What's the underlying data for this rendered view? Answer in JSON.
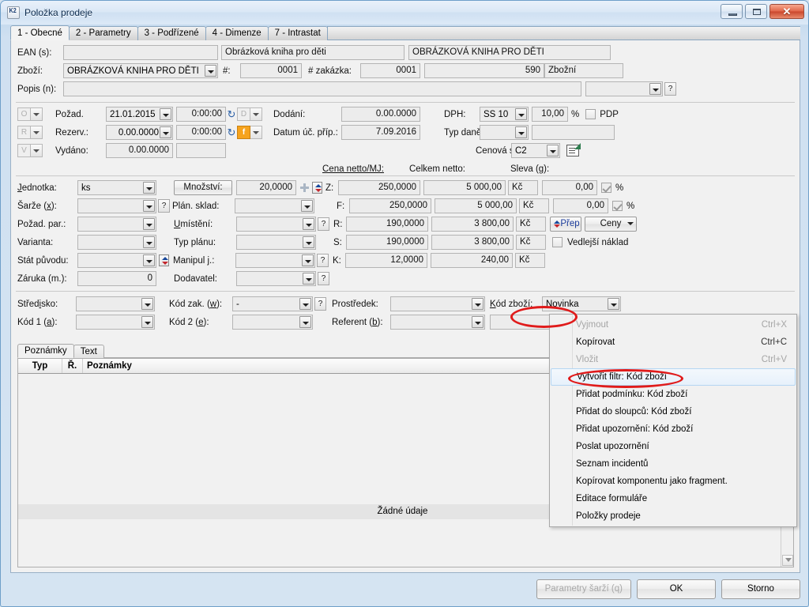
{
  "window": {
    "title": "Položka prodeje",
    "icon": "k2-app-icon",
    "buttons": {
      "minimize": "minimize-icon",
      "maximize": "maximize-icon",
      "close": "✕"
    }
  },
  "tabs": [
    {
      "label": "1 - Obecné",
      "active": true
    },
    {
      "label": "2 - Parametry",
      "active": false
    },
    {
      "label": "3 - Podřízené",
      "active": false
    },
    {
      "label": "4 - Dimenze",
      "active": false
    },
    {
      "label": "7 - Intrastat",
      "active": false
    }
  ],
  "header": {
    "ean_label": "EAN (s):",
    "ean_value": "",
    "ean_desc1": "Obrázková kniha pro děti",
    "ean_desc2": "OBRÁZKOVÁ KNIHA PRO DĚTI",
    "zbozi_label": "Zboží:",
    "zbozi_value": "OBRÁZKOVÁ KNIHA PRO DĚTI",
    "hash_label": "#:",
    "hash_value": "0001",
    "zakazka_label": "# zakázka:",
    "zakazka_value": "0001",
    "code_value": "590",
    "code_desc": "Zbožní",
    "popis_label": "Popis (n):",
    "popis_value": "",
    "popis_combo_value": "",
    "popis_help": "?"
  },
  "dates": {
    "pozad_prefix": "O",
    "pozad_label": "Požad.",
    "pozad_date": "21.01.2015",
    "pozad_time": "0:00:00",
    "rezerv_prefix": "R",
    "rezerv_label": "Rezerv.:",
    "rezerv_date": "0.00.0000",
    "rezerv_time": "0:00:00",
    "vydano_prefix": "V",
    "vydano_label": "Vydáno:",
    "vydano_date": "0.00.0000",
    "vydano_time": "",
    "dodani_prefix": "D",
    "dodani_label": "Dodání:",
    "dodani_value": "0.00.0000",
    "datum_uc_prefix": "f",
    "datum_uc_label": "Datum úč. příp.:",
    "datum_uc_value": "7.09.2016",
    "dph_label": "DPH:",
    "dph_combo": "SS 10",
    "dph_rate": "10,00",
    "dph_pct": "%",
    "pdp_label": "PDP",
    "pdp_checked": false,
    "typ_dane_label": "Typ daně:",
    "typ_dane_combo": "",
    "typ_dane_value": "",
    "cenova_sk_label": "Cenová sk.(l):",
    "cenova_sk_combo": "C2",
    "cenova_sk_icon": "edit-note-icon"
  },
  "prices": {
    "col_cena_netto": "Cena netto/MJ:",
    "col_celkem_netto": "Celkem netto:",
    "col_sleva": "Sleva (g):",
    "left_labels": {
      "jednotka": "Jednotka:",
      "sarze": "Šarže (x):",
      "pozad_par": "Požad. par.:",
      "varianta": "Varianta:",
      "stat_puvodu": "Stát původu:",
      "zaruka": "Záruka (m.):"
    },
    "left_values": {
      "jednotka": "ks",
      "sarze": "",
      "pozad_par": "",
      "varianta": "",
      "stat_puvodu": "",
      "zaruka": "0"
    },
    "mid_labels": {
      "mnozstvi": "Množství:",
      "plan_sklad": "Plán. sklad:",
      "umisteni": "Umístění:",
      "typ_planu": "Typ plánu:",
      "manipul_j": "Manipul j.:",
      "dodavatel": "Dodavatel:"
    },
    "mid_values": {
      "mnozstvi": "20,0000",
      "plan_sklad": "",
      "umisteni": "",
      "typ_planu": "",
      "manipul_j": "",
      "dodavatel": ""
    },
    "rows": [
      {
        "key": "Z:",
        "unit_price": "250,0000",
        "total": "5 000,00",
        "currency": "Kč",
        "discount": "0,00",
        "pct": "%"
      },
      {
        "key": "F:",
        "unit_price": "250,0000",
        "total": "5 000,00",
        "currency": "Kč",
        "discount": "0,00",
        "pct": "%"
      },
      {
        "key": "R:",
        "unit_price": "190,0000",
        "total": "3 800,00",
        "currency": "Kč"
      },
      {
        "key": "S:",
        "unit_price": "190,0000",
        "total": "3 800,00",
        "currency": "Kč"
      },
      {
        "key": "K:",
        "unit_price": "12,0000",
        "total": "240,00",
        "currency": "Kč"
      }
    ],
    "prep_button": "Přep",
    "ceny_button": "Ceny",
    "vedlejsi_naklad_label": "Vedlejší náklad",
    "vedlejsi_naklad_checked": false
  },
  "codes": {
    "stredisko_label": "Středisko:",
    "stredisko_value": "",
    "kod1_label": "Kód 1 (a):",
    "kod1_value": "",
    "kod_zak_label": "Kód zak. (w):",
    "kod_zak_value": "-",
    "kod2_label": "Kód 2 (e):",
    "kod2_value": "",
    "prostredek_label": "Prostředek:",
    "prostredek_value": "",
    "referent_label": "Referent (b):",
    "referent_value": "",
    "kod_zbozi_label": "Kód zboží:",
    "kod_zbozi_value": "Novinka",
    "extra_value": ""
  },
  "notes": {
    "tabs": [
      {
        "label": "Poznámky",
        "active": true
      },
      {
        "label": "Text",
        "active": false
      }
    ],
    "columns": [
      "Typ",
      "Ř.",
      "Poznámky"
    ],
    "rows": [],
    "summary": "Žádné údaje"
  },
  "context_menu": {
    "items": [
      {
        "label": "Vyjmout",
        "accel": "Ctrl+X",
        "disabled": true,
        "selected": false
      },
      {
        "label": "Kopírovat",
        "accel": "Ctrl+C",
        "disabled": false,
        "selected": false
      },
      {
        "label": "Vložit",
        "accel": "Ctrl+V",
        "disabled": true,
        "selected": false
      },
      {
        "label": "Vytvořit filtr: Kód zboží",
        "accel": "",
        "disabled": false,
        "selected": true
      },
      {
        "label": "Přidat podmínku: Kód zboží",
        "accel": "",
        "disabled": false,
        "selected": false
      },
      {
        "label": "Přidat do sloupců: Kód zboží",
        "accel": "",
        "disabled": false,
        "selected": false
      },
      {
        "label": "Přidat upozornění: Kód zboží",
        "accel": "",
        "disabled": false,
        "selected": false
      },
      {
        "label": "Poslat upozornění",
        "accel": "",
        "disabled": false,
        "selected": false
      },
      {
        "label": "Seznam incidentů",
        "accel": "",
        "disabled": false,
        "selected": false
      },
      {
        "label": "Kopírovat komponentu jako fragment.",
        "accel": "",
        "disabled": false,
        "selected": false
      },
      {
        "label": "Editace formuláře",
        "accel": "",
        "disabled": false,
        "selected": false
      },
      {
        "label": "Položky prodeje",
        "accel": "",
        "disabled": false,
        "selected": false
      }
    ]
  },
  "footer": {
    "parametry_sarzi": "Parametry šarží (q)",
    "ok": "OK",
    "storno": "Storno"
  },
  "annotations": {
    "highlight_color": "#e01b1b",
    "circled_field": "Kód zboží:",
    "circled_menu_item": "Vytvořit filtr: Kód zboží"
  }
}
